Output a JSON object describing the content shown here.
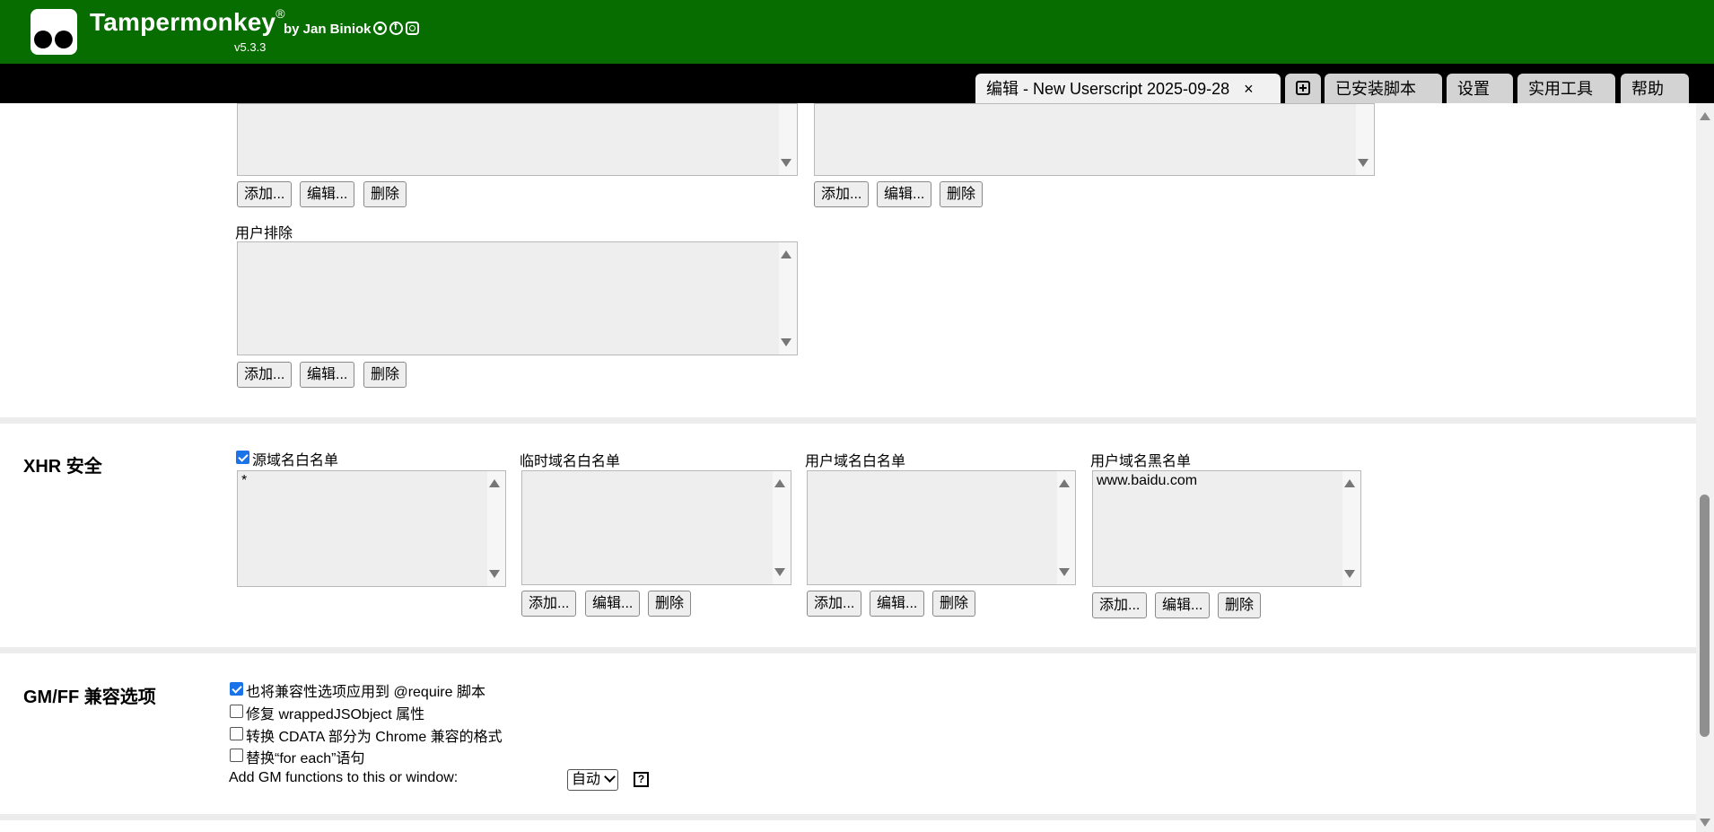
{
  "header": {
    "app_name": "Tampermonkey",
    "registered": "®",
    "byline": "by Jan Biniok",
    "version": "v5.3.3",
    "social_icons": [
      "github-icon",
      "facebook-icon",
      "instagram-icon"
    ],
    "brand_color": "#086d00"
  },
  "tabs": {
    "active_label": "编辑 - New Userscript 2025-09-28",
    "close": "×",
    "add_icon": "plus-square-icon",
    "installed": "已安装脚本",
    "settings": "设置",
    "utilities": "实用工具",
    "help": "帮助"
  },
  "buttons": {
    "add": "添加...",
    "edit": "编辑...",
    "delete": "删除"
  },
  "top_section": {
    "user_exclude_label": "用户排除"
  },
  "xhr": {
    "title": "XHR 安全",
    "source_whitelist": {
      "label": "源域名白名单",
      "checked": true,
      "items": [
        "*"
      ]
    },
    "temp_whitelist": {
      "label": "临时域名白名单",
      "items": []
    },
    "user_whitelist": {
      "label": "用户域名白名单",
      "items": []
    },
    "user_blacklist": {
      "label": "用户域名黑名单",
      "items": [
        "www.baidu.com"
      ]
    }
  },
  "gmff": {
    "title": "GM/FF 兼容选项",
    "options": [
      {
        "label": "也将兼容性选项应用到 @require 脚本",
        "checked": true
      },
      {
        "label": "修复 wrappedJSObject 属性",
        "checked": false
      },
      {
        "label": "转换 CDATA 部分为 Chrome 兼容的格式",
        "checked": false
      },
      {
        "label": "替换“for each”语句",
        "checked": false
      }
    ],
    "gm_functions_label": "Add GM functions to this or window:",
    "gm_functions_value": "自动",
    "help_icon": "?"
  }
}
